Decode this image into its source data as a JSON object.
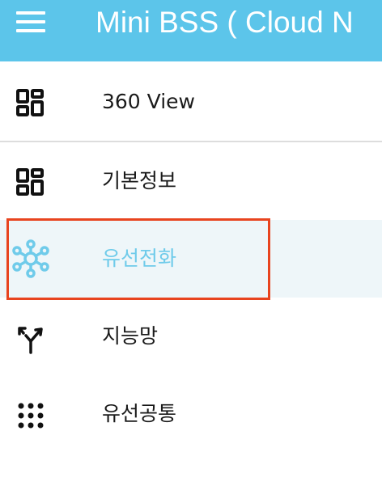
{
  "appbar": {
    "title": "Mini BSS ( Cloud N",
    "background_color": "#5cc5ea",
    "menu_icon": "hamburger-menu-icon"
  },
  "nav": {
    "items": [
      {
        "label": "360 View",
        "icon": "dashboard-grid-icon"
      },
      {
        "label": "기본정보",
        "icon": "dashboard-grid-icon"
      },
      {
        "label": "유선전화",
        "icon": "network-hub-icon",
        "active": true,
        "active_color": "#6fcbea"
      },
      {
        "label": "지능망",
        "icon": "split-arrows-icon"
      },
      {
        "label": "유선공통",
        "icon": "dot-grid-icon"
      }
    ]
  },
  "highlight_color": "#e8441f"
}
